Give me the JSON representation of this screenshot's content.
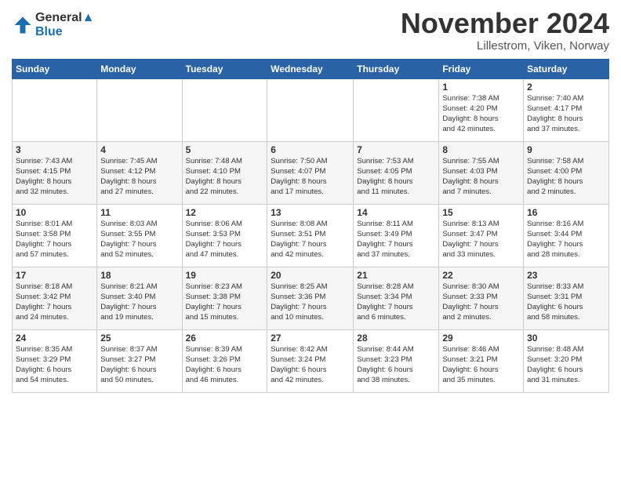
{
  "logo": {
    "line1": "General",
    "line2": "Blue"
  },
  "title": "November 2024",
  "subtitle": "Lillestrom, Viken, Norway",
  "weekdays": [
    "Sunday",
    "Monday",
    "Tuesday",
    "Wednesday",
    "Thursday",
    "Friday",
    "Saturday"
  ],
  "weeks": [
    [
      {
        "day": "",
        "info": ""
      },
      {
        "day": "",
        "info": ""
      },
      {
        "day": "",
        "info": ""
      },
      {
        "day": "",
        "info": ""
      },
      {
        "day": "",
        "info": ""
      },
      {
        "day": "1",
        "info": "Sunrise: 7:38 AM\nSunset: 4:20 PM\nDaylight: 8 hours\nand 42 minutes."
      },
      {
        "day": "2",
        "info": "Sunrise: 7:40 AM\nSunset: 4:17 PM\nDaylight: 8 hours\nand 37 minutes."
      }
    ],
    [
      {
        "day": "3",
        "info": "Sunrise: 7:43 AM\nSunset: 4:15 PM\nDaylight: 8 hours\nand 32 minutes."
      },
      {
        "day": "4",
        "info": "Sunrise: 7:45 AM\nSunset: 4:12 PM\nDaylight: 8 hours\nand 27 minutes."
      },
      {
        "day": "5",
        "info": "Sunrise: 7:48 AM\nSunset: 4:10 PM\nDaylight: 8 hours\nand 22 minutes."
      },
      {
        "day": "6",
        "info": "Sunrise: 7:50 AM\nSunset: 4:07 PM\nDaylight: 8 hours\nand 17 minutes."
      },
      {
        "day": "7",
        "info": "Sunrise: 7:53 AM\nSunset: 4:05 PM\nDaylight: 8 hours\nand 11 minutes."
      },
      {
        "day": "8",
        "info": "Sunrise: 7:55 AM\nSunset: 4:03 PM\nDaylight: 8 hours\nand 7 minutes."
      },
      {
        "day": "9",
        "info": "Sunrise: 7:58 AM\nSunset: 4:00 PM\nDaylight: 8 hours\nand 2 minutes."
      }
    ],
    [
      {
        "day": "10",
        "info": "Sunrise: 8:01 AM\nSunset: 3:58 PM\nDaylight: 7 hours\nand 57 minutes."
      },
      {
        "day": "11",
        "info": "Sunrise: 8:03 AM\nSunset: 3:55 PM\nDaylight: 7 hours\nand 52 minutes."
      },
      {
        "day": "12",
        "info": "Sunrise: 8:06 AM\nSunset: 3:53 PM\nDaylight: 7 hours\nand 47 minutes."
      },
      {
        "day": "13",
        "info": "Sunrise: 8:08 AM\nSunset: 3:51 PM\nDaylight: 7 hours\nand 42 minutes."
      },
      {
        "day": "14",
        "info": "Sunrise: 8:11 AM\nSunset: 3:49 PM\nDaylight: 7 hours\nand 37 minutes."
      },
      {
        "day": "15",
        "info": "Sunrise: 8:13 AM\nSunset: 3:47 PM\nDaylight: 7 hours\nand 33 minutes."
      },
      {
        "day": "16",
        "info": "Sunrise: 8:16 AM\nSunset: 3:44 PM\nDaylight: 7 hours\nand 28 minutes."
      }
    ],
    [
      {
        "day": "17",
        "info": "Sunrise: 8:18 AM\nSunset: 3:42 PM\nDaylight: 7 hours\nand 24 minutes."
      },
      {
        "day": "18",
        "info": "Sunrise: 8:21 AM\nSunset: 3:40 PM\nDaylight: 7 hours\nand 19 minutes."
      },
      {
        "day": "19",
        "info": "Sunrise: 8:23 AM\nSunset: 3:38 PM\nDaylight: 7 hours\nand 15 minutes."
      },
      {
        "day": "20",
        "info": "Sunrise: 8:25 AM\nSunset: 3:36 PM\nDaylight: 7 hours\nand 10 minutes."
      },
      {
        "day": "21",
        "info": "Sunrise: 8:28 AM\nSunset: 3:34 PM\nDaylight: 7 hours\nand 6 minutes."
      },
      {
        "day": "22",
        "info": "Sunrise: 8:30 AM\nSunset: 3:33 PM\nDaylight: 7 hours\nand 2 minutes."
      },
      {
        "day": "23",
        "info": "Sunrise: 8:33 AM\nSunset: 3:31 PM\nDaylight: 6 hours\nand 58 minutes."
      }
    ],
    [
      {
        "day": "24",
        "info": "Sunrise: 8:35 AM\nSunset: 3:29 PM\nDaylight: 6 hours\nand 54 minutes."
      },
      {
        "day": "25",
        "info": "Sunrise: 8:37 AM\nSunset: 3:27 PM\nDaylight: 6 hours\nand 50 minutes."
      },
      {
        "day": "26",
        "info": "Sunrise: 8:39 AM\nSunset: 3:26 PM\nDaylight: 6 hours\nand 46 minutes."
      },
      {
        "day": "27",
        "info": "Sunrise: 8:42 AM\nSunset: 3:24 PM\nDaylight: 6 hours\nand 42 minutes."
      },
      {
        "day": "28",
        "info": "Sunrise: 8:44 AM\nSunset: 3:23 PM\nDaylight: 6 hours\nand 38 minutes."
      },
      {
        "day": "29",
        "info": "Sunrise: 8:46 AM\nSunset: 3:21 PM\nDaylight: 6 hours\nand 35 minutes."
      },
      {
        "day": "30",
        "info": "Sunrise: 8:48 AM\nSunset: 3:20 PM\nDaylight: 6 hours\nand 31 minutes."
      }
    ]
  ]
}
